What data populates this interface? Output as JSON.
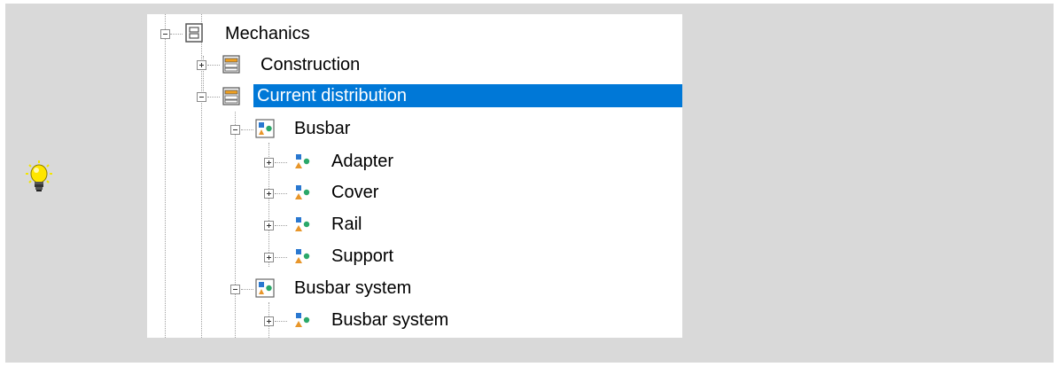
{
  "tree": {
    "nodes": [
      {
        "label": "Mechanics",
        "icon": "folder-module-icon",
        "expanded": true
      },
      {
        "label": "Construction",
        "icon": "drawer-stack-icon",
        "expanded": false
      },
      {
        "label": "Current distribution",
        "icon": "drawer-stack-icon",
        "expanded": true,
        "selected": true
      },
      {
        "label": "Busbar",
        "icon": "component-group-icon",
        "expanded": true
      },
      {
        "label": "Adapter",
        "icon": "component-icon",
        "expanded": false
      },
      {
        "label": "Cover",
        "icon": "component-icon",
        "expanded": false
      },
      {
        "label": "Rail",
        "icon": "component-icon",
        "expanded": false
      },
      {
        "label": "Support",
        "icon": "component-icon",
        "expanded": false
      },
      {
        "label": "Busbar system",
        "icon": "component-group-icon",
        "expanded": true
      },
      {
        "label": "Busbar system",
        "icon": "component-icon",
        "expanded": false
      }
    ]
  },
  "colors": {
    "selection": "#0078d7",
    "panel_background": "#d9d9d9",
    "tree_background": "#ffffff"
  },
  "hint": {
    "icon": "lightbulb-icon"
  }
}
